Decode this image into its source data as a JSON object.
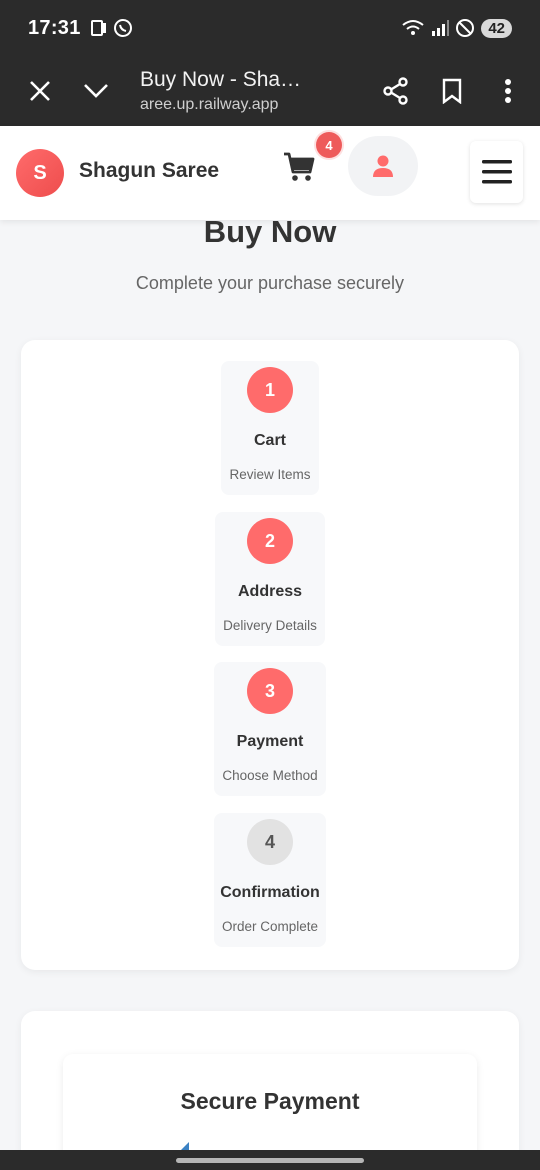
{
  "status_bar": {
    "time": "17:31",
    "battery": "42"
  },
  "browser": {
    "title": "Buy Now - Sha…",
    "url": "aree.up.railway.app"
  },
  "header": {
    "logo_letter": "S",
    "brand": "Shagun Saree",
    "cart_count": "4"
  },
  "page": {
    "title": "Buy Now",
    "subtitle": "Complete your purchase securely"
  },
  "steps": [
    {
      "number": "1",
      "name": "Cart",
      "desc": "Review Items",
      "active": true
    },
    {
      "number": "2",
      "name": "Address",
      "desc": "Delivery Details",
      "active": true
    },
    {
      "number": "3",
      "name": "Payment",
      "desc": "Choose Method",
      "active": true
    },
    {
      "number": "4",
      "name": "Confirmation",
      "desc": "Order Complete",
      "active": false
    }
  ],
  "payment": {
    "title": "Secure Payment"
  },
  "colors": {
    "accent": "#ff6b6b",
    "inactive": "#e2e2e2",
    "browser_bg": "#2b2b2b"
  }
}
